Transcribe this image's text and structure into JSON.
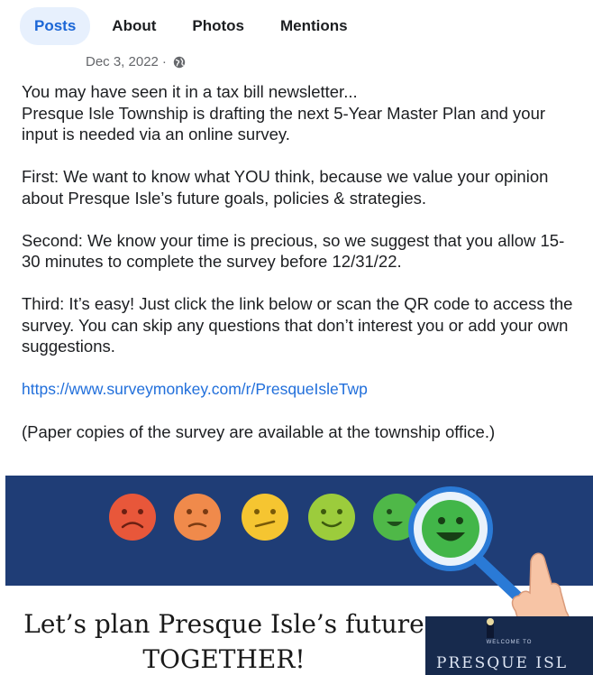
{
  "tabs": [
    {
      "label": "Posts",
      "active": true
    },
    {
      "label": "About",
      "active": false
    },
    {
      "label": "Photos",
      "active": false
    },
    {
      "label": "Mentions",
      "active": false
    }
  ],
  "post": {
    "date": "Dec 3, 2022",
    "separator": "·",
    "audience_icon": "globe-icon",
    "paragraphs": [
      "You may have seen it in a tax bill newsletter...\nPresque Isle Township is drafting the next 5-Year Master Plan and your input is needed via an online survey.",
      "First: We want to know what YOU think, because we value your opinion about Presque Isle’s future goals, policies & strategies.",
      "Second: We know your time is precious, so we suggest that you allow 15-30 minutes to complete the survey before 12/31/22.",
      "Third: It’s easy! Just click the link below or scan the QR code to access the survey. You can skip any questions that don’t interest you or add your own suggestions."
    ],
    "link": "https://www.surveymonkey.com/r/PresqueIsleTwp",
    "note": "(Paper copies of the survey are available at the township office.)"
  },
  "image": {
    "headline_line1": "Let’s plan Presque Isle’s future",
    "headline_line2": "TOGETHER!",
    "sign_small": "WELCOME TO",
    "sign_large": "PRESQUE ISL",
    "colors": {
      "banner_bg": "#1f3d76",
      "face_red": "#e8573a",
      "face_orange": "#f08a4b",
      "face_yellow": "#f5c531",
      "face_lightgreen": "#9ccc3c",
      "face_green": "#4fb848",
      "accent_blue": "#1b66d6"
    },
    "icons": [
      "sad-face-icon",
      "frown-face-icon",
      "neutral-face-icon",
      "smile-face-icon",
      "happy-face-icon",
      "magnifier-icon",
      "pointing-hand-icon"
    ]
  }
}
